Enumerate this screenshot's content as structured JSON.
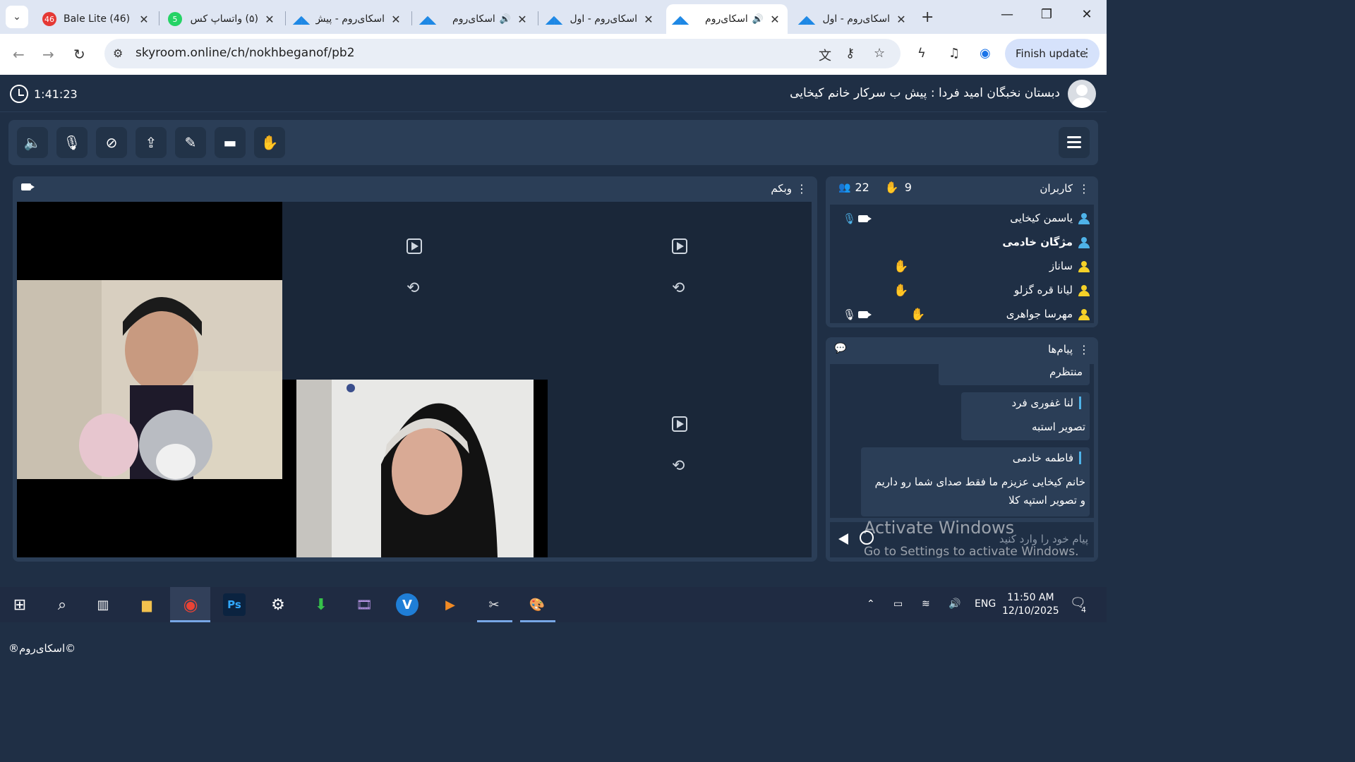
{
  "browser": {
    "tabs": [
      {
        "title": "Bale Lite (46)",
        "favicon_text": "46",
        "favicon_color": "#e53935",
        "sound": false
      },
      {
        "title": "(۵) واتساپ کس",
        "favicon_text": "5",
        "favicon_color": "#25d366",
        "sound": false
      },
      {
        "title": "اسکای‌روم - پیش",
        "favicon_text": "",
        "favicon_color": "#1e88e5",
        "sound": false
      },
      {
        "title": "اسکای‌روم",
        "favicon_text": "",
        "favicon_color": "#1e88e5",
        "sound": true
      },
      {
        "title": "اسکای‌روم - اول",
        "favicon_text": "",
        "favicon_color": "#1e88e5",
        "sound": false
      },
      {
        "title": "اسکای‌روم",
        "favicon_text": "",
        "favicon_color": "#1e88e5",
        "sound": true,
        "active": true
      },
      {
        "title": "اسکای‌روم - اول",
        "favicon_text": "",
        "favicon_color": "#1e88e5",
        "sound": false
      }
    ],
    "url": "skyroom.online/ch/nokhbeganof/pb2",
    "finish_update": "Finish update"
  },
  "room": {
    "timer": "1:41:23",
    "title": "دبستان نخبگان امید فردا : پیش ب سرکار خانم کیخایی"
  },
  "webcam": {
    "title": "وبکم"
  },
  "users": {
    "title": "کاربران",
    "count": "22",
    "hands": "9",
    "list": [
      {
        "name": "یاسمن کیخایی",
        "role_color": "#4fb3e9",
        "bold": false,
        "mic": true,
        "cam": true,
        "hand": false
      },
      {
        "name": "مژگان خادمی",
        "role_color": "#4fb3e9",
        "bold": true,
        "mic": false,
        "cam": false,
        "hand": false
      },
      {
        "name": "ساناز",
        "role_color": "#f5d128",
        "bold": false,
        "mic": false,
        "cam": false,
        "hand": true
      },
      {
        "name": "لیانا قره گزلو",
        "role_color": "#f5d128",
        "bold": false,
        "mic": false,
        "cam": false,
        "hand": true
      },
      {
        "name": "مهرسا جواهری",
        "role_color": "#f5d128",
        "bold": false,
        "mic": true,
        "cam": true,
        "hand": true
      }
    ]
  },
  "messages": {
    "title": "پیام‌ها",
    "items": [
      {
        "sender": "",
        "text": "منتظرم"
      },
      {
        "sender": "لنا غفوری فرد",
        "text": "تصویر استبه"
      },
      {
        "sender": "فاطمه خادمی",
        "text": "خانم کیخایی عزیزم ما فقط صدای شما رو داریم و تصویر استپه کلا"
      }
    ],
    "input_placeholder": "پیام خود را وارد کنید"
  },
  "watermark": {
    "line1": "Activate Windows",
    "line2": "Go to Settings to activate Windows."
  },
  "footer": "©اسکای‌روم®",
  "taskbar": {
    "language": "ENG",
    "time": "11:50 AM",
    "date": "12/10/2025",
    "notifications": "4"
  }
}
